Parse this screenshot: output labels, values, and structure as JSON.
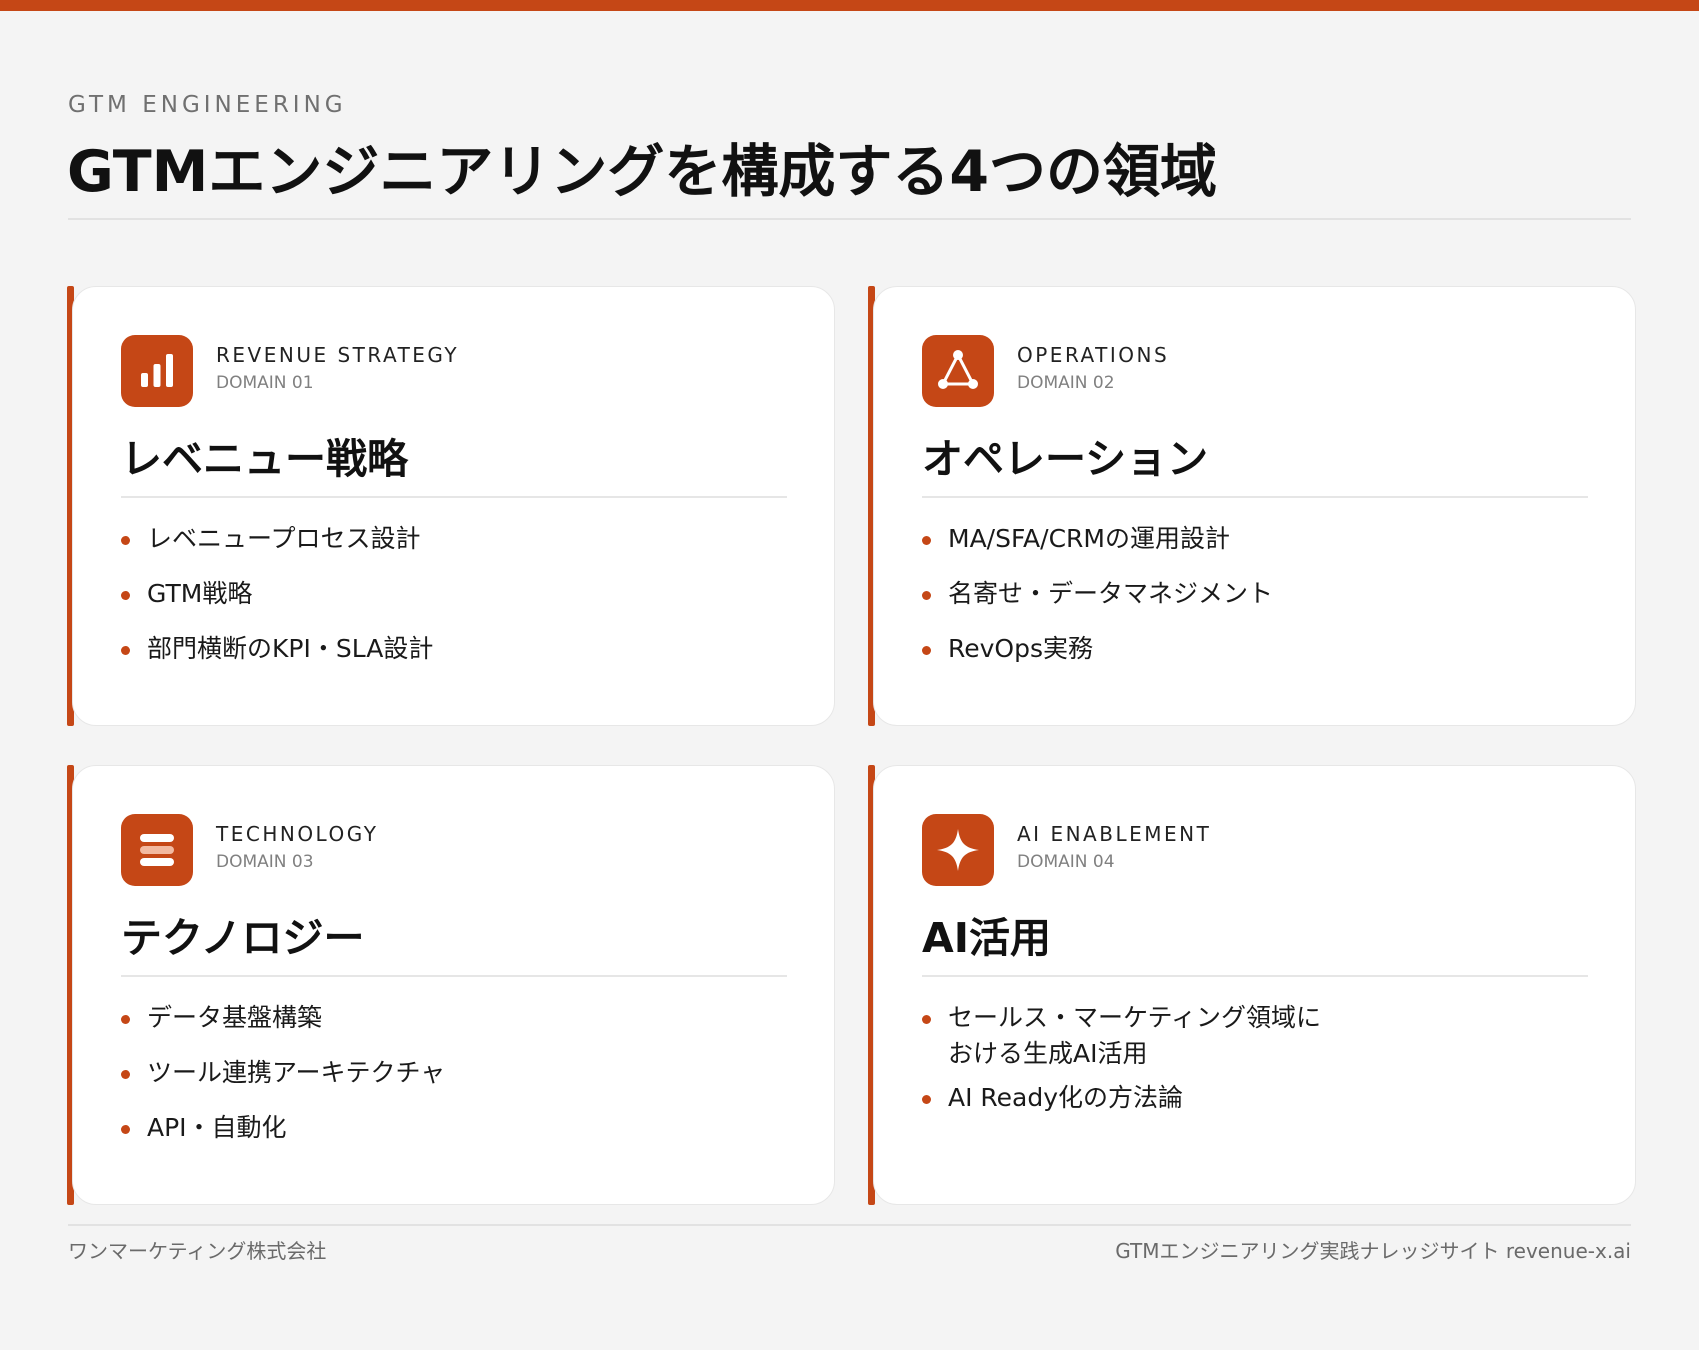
{
  "header": {
    "kicker": "GTM ENGINEERING",
    "title": "GTMエンジニアリングを構成する4つの領域"
  },
  "domains": [
    {
      "icon": "bar-chart-icon",
      "label_en": "REVENUE STRATEGY",
      "number": "DOMAIN 01",
      "title": "レベニュー戦略",
      "items": [
        "レベニュープロセス設計",
        "GTM戦略",
        "部門横断のKPI・SLA設計"
      ]
    },
    {
      "icon": "network-triangle-icon",
      "label_en": "OPERATIONS",
      "number": "DOMAIN 02",
      "title": "オペレーション",
      "items": [
        "MA/SFA/CRMの運用設計",
        "名寄せ・データマネジメント",
        "RevOps実務"
      ]
    },
    {
      "icon": "stack-layers-icon",
      "label_en": "TECHNOLOGY",
      "number": "DOMAIN 03",
      "title": "テクノロジー",
      "items": [
        "データ基盤構築",
        "ツール連携アーキテクチャ",
        "API・自動化"
      ]
    },
    {
      "icon": "sparkle-icon",
      "label_en": "AI ENABLEMENT",
      "number": "DOMAIN 04",
      "title": "AI活用",
      "items": [
        "セールス・マーケティング領域における生成AI活用",
        "AI Ready化の方法論"
      ]
    }
  ],
  "footer": {
    "company": "ワンマーケティング株式会社",
    "site": "GTMエンジニアリング実践ナレッジサイト revenue-x.ai"
  },
  "colors": {
    "accent": "#c54716",
    "background": "#f4f4f4",
    "card": "#ffffff"
  }
}
